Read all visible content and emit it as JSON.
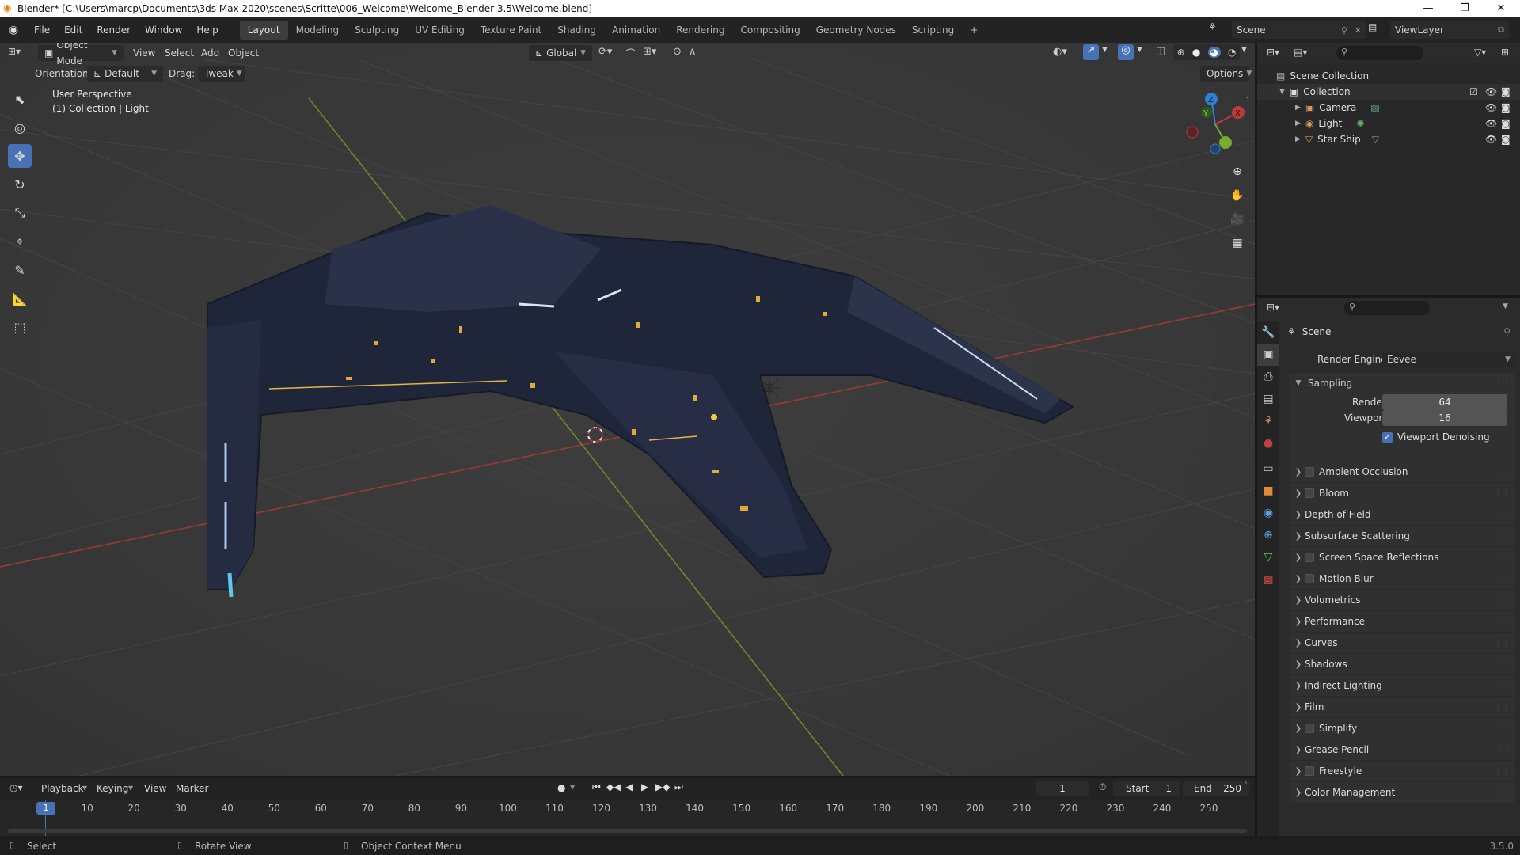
{
  "window": {
    "title": "Blender* [C:\\Users\\marcp\\Documents\\3ds Max 2020\\scenes\\Scritte\\006_Welcome\\Welcome_Blender 3.5\\Welcome.blend]",
    "minimize": "—",
    "maximize": "❐",
    "close": "✕"
  },
  "menu": {
    "items": [
      "File",
      "Edit",
      "Render",
      "Window",
      "Help"
    ],
    "workspaces": [
      "Layout",
      "Modeling",
      "Sculpting",
      "UV Editing",
      "Texture Paint",
      "Shading",
      "Animation",
      "Rendering",
      "Compositing",
      "Geometry Nodes",
      "Scripting"
    ],
    "add_workspace": "+",
    "scene_label": "Scene",
    "viewlayer_label": "ViewLayer"
  },
  "viewport": {
    "mode": "Object Mode",
    "menus": [
      "View",
      "Select",
      "Add",
      "Object"
    ],
    "transform_orientation": "Global",
    "orientation_label": "Orientation:",
    "orientation_value": "Default",
    "drag_label": "Drag:",
    "drag_value": "Tweak",
    "options_label": "Options",
    "overlay_title": "User Perspective",
    "overlay_subtitle": "(1) Collection | Light",
    "gizmo": {
      "x": "X",
      "y": "Y",
      "z": "Z"
    }
  },
  "outliner": {
    "root": "Scene Collection",
    "collection": "Collection",
    "items": [
      {
        "name": "Camera",
        "color": "#d29a5a"
      },
      {
        "name": "Light",
        "color": "#d29a5a"
      },
      {
        "name": "Star Ship",
        "color": "#d29a5a"
      }
    ]
  },
  "properties": {
    "title": "Scene",
    "render_engine_label": "Render Engine",
    "render_engine_value": "Eevee",
    "sampling": {
      "label": "Sampling",
      "render_label": "Render",
      "render_value": "64",
      "viewport_label": "Viewport",
      "viewport_value": "16",
      "denoise_label": "Viewport Denoising",
      "denoise_checked": true
    },
    "panels": [
      {
        "label": "Ambient Occlusion",
        "checkbox": true
      },
      {
        "label": "Bloom",
        "checkbox": true
      },
      {
        "label": "Depth of Field",
        "checkbox": false
      },
      {
        "label": "Subsurface Scattering",
        "checkbox": false
      },
      {
        "label": "Screen Space Reflections",
        "checkbox": true
      },
      {
        "label": "Motion Blur",
        "checkbox": true
      },
      {
        "label": "Volumetrics",
        "checkbox": false
      },
      {
        "label": "Performance",
        "checkbox": false
      },
      {
        "label": "Curves",
        "checkbox": false
      },
      {
        "label": "Shadows",
        "checkbox": false
      },
      {
        "label": "Indirect Lighting",
        "checkbox": false
      },
      {
        "label": "Film",
        "checkbox": false
      },
      {
        "label": "Simplify",
        "checkbox": true
      },
      {
        "label": "Grease Pencil",
        "checkbox": false
      },
      {
        "label": "Freestyle",
        "checkbox": true
      },
      {
        "label": "Color Management",
        "checkbox": false
      }
    ]
  },
  "timeline": {
    "menus": [
      "Playback",
      "Keying",
      "View",
      "Marker"
    ],
    "current_frame": "1",
    "start_label": "Start",
    "start_value": "1",
    "end_label": "End",
    "end_value": "250",
    "ticks": [
      "1",
      "10",
      "20",
      "30",
      "40",
      "50",
      "60",
      "70",
      "80",
      "90",
      "100",
      "110",
      "120",
      "130",
      "140",
      "150",
      "160",
      "170",
      "180",
      "190",
      "200",
      "210",
      "220",
      "230",
      "240",
      "250"
    ]
  },
  "statusbar": {
    "select": "Select",
    "rotate": "Rotate View",
    "context": "Object Context Menu",
    "version": "3.5.0"
  },
  "colors": {
    "accent": "#4772b3",
    "x_axis": "#c0393b",
    "y_axis": "#7aab2f",
    "z_axis": "#2f7fd4"
  }
}
